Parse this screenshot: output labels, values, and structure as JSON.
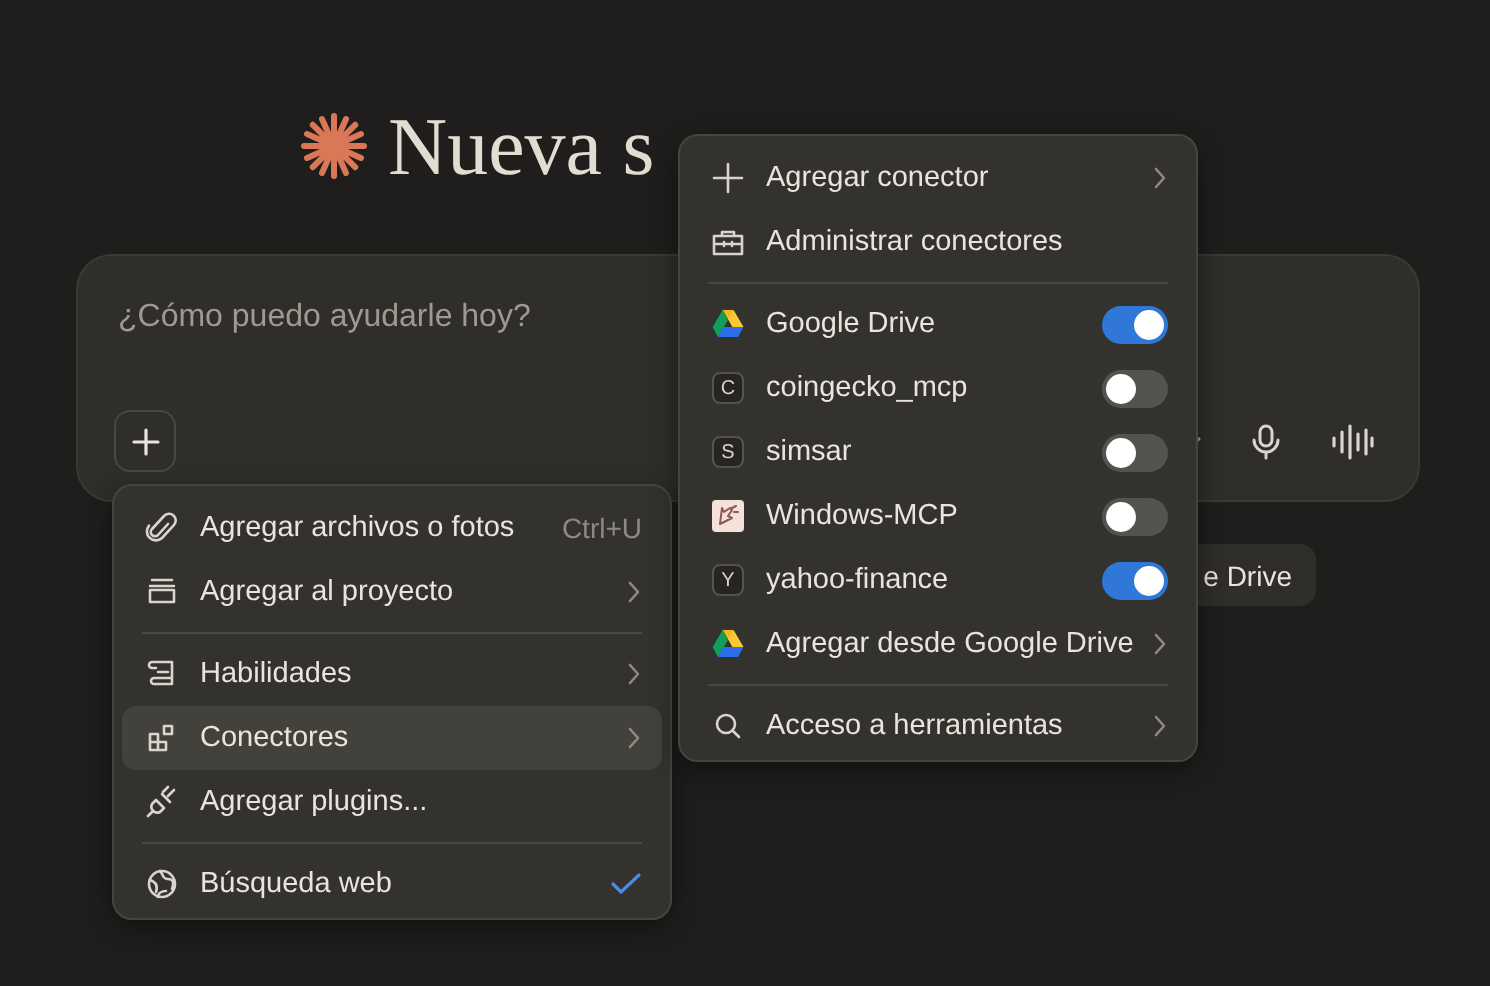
{
  "heading": {
    "text": "Nueva s"
  },
  "composer": {
    "placeholder": "¿Cómo puedo ayudarle hoy?"
  },
  "chip": {
    "label": "e Drive"
  },
  "attach_menu": {
    "items": [
      {
        "kind": "item",
        "label": "Agregar archivos o fotos",
        "shortcut": "Ctrl+U",
        "submenu": false,
        "selected": false,
        "checked": false
      },
      {
        "kind": "item",
        "label": "Agregar al proyecto",
        "submenu": true,
        "selected": false,
        "checked": false
      },
      {
        "kind": "separator"
      },
      {
        "kind": "item",
        "label": "Habilidades",
        "submenu": true,
        "selected": false,
        "checked": false
      },
      {
        "kind": "item",
        "label": "Conectores",
        "submenu": true,
        "selected": true,
        "checked": false
      },
      {
        "kind": "item",
        "label": "Agregar plugins...",
        "submenu": false,
        "selected": false,
        "checked": false
      },
      {
        "kind": "separator"
      },
      {
        "kind": "item",
        "label": "Búsqueda web",
        "submenu": false,
        "selected": false,
        "checked": true
      }
    ]
  },
  "connector_menu": {
    "items": [
      {
        "kind": "action",
        "label": "Agregar conector",
        "submenu": true
      },
      {
        "kind": "action",
        "label": "Administrar conectores",
        "submenu": false
      },
      {
        "kind": "separator"
      },
      {
        "kind": "toggle",
        "label": "Google Drive",
        "on": true
      },
      {
        "kind": "toggle",
        "badge": "C",
        "label": "coingecko_mcp",
        "on": false
      },
      {
        "kind": "toggle",
        "badge": "S",
        "label": "simsar",
        "on": false
      },
      {
        "kind": "toggle",
        "label": "Windows-MCP",
        "on": false
      },
      {
        "kind": "toggle",
        "badge": "Y",
        "label": "yahoo-finance",
        "on": true
      },
      {
        "kind": "action",
        "label": "Agregar desde Google Drive",
        "submenu": true
      },
      {
        "kind": "separator"
      },
      {
        "kind": "action",
        "label": "Acceso a herramientas",
        "submenu": true
      }
    ]
  }
}
